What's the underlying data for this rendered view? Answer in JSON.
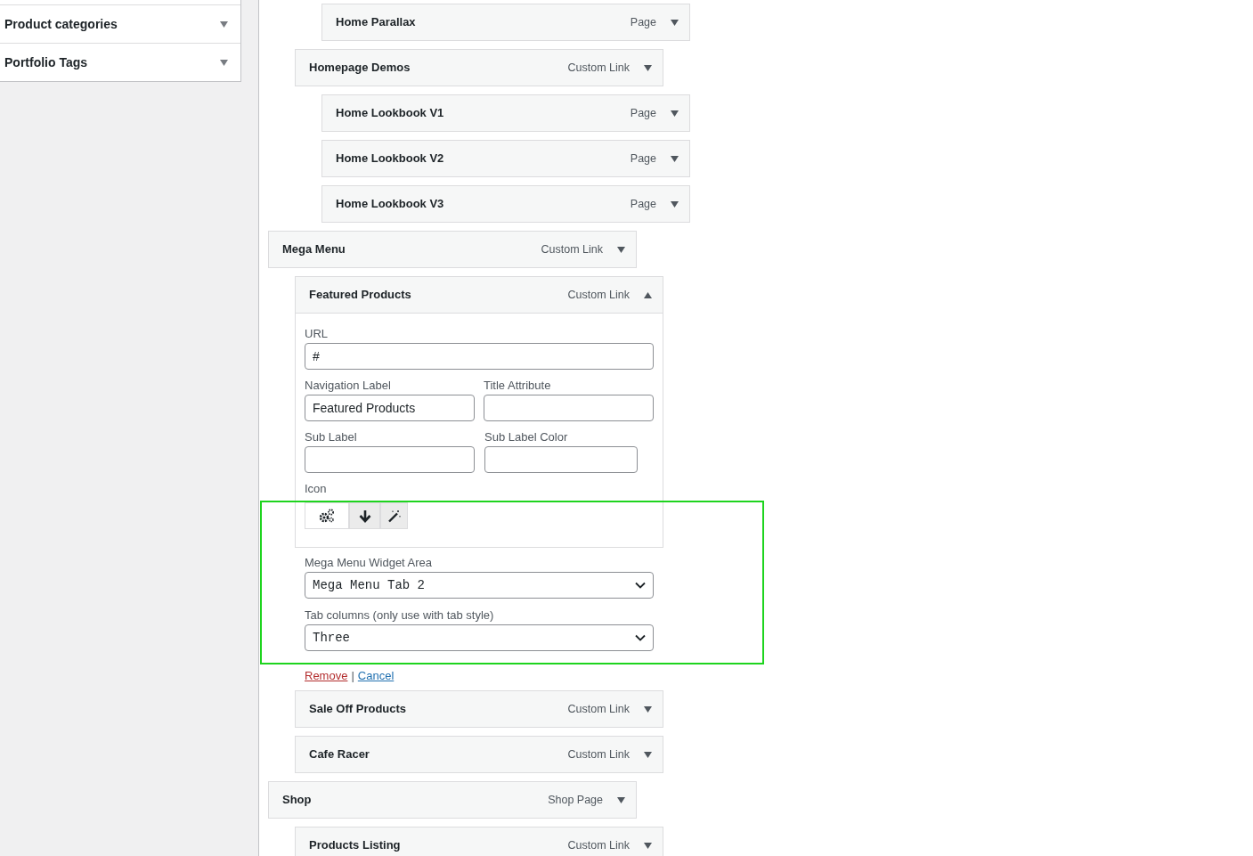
{
  "sidebar": {
    "sections": [
      {
        "title": "Product categories",
        "expanded": false
      },
      {
        "title": "Portfolio Tags",
        "expanded": false
      }
    ]
  },
  "menu_items": [
    {
      "children": [
        {
          "children": [
            {
              "title": "Home Parallax",
              "type": "Page",
              "expanded": false
            }
          ]
        },
        {
          "title": "Homepage Demos",
          "type": "Custom Link",
          "expanded": false,
          "children": [
            {
              "title": "Home Lookbook V1",
              "type": "Page",
              "expanded": false
            },
            {
              "title": "Home Lookbook V2",
              "type": "Page",
              "expanded": false
            },
            {
              "title": "Home Lookbook V3",
              "type": "Page",
              "expanded": false
            }
          ]
        }
      ]
    },
    {
      "title": "Mega Menu",
      "type": "Custom Link",
      "expanded": false,
      "children": [
        {
          "title": "Featured Products",
          "type": "Custom Link",
          "expanded": true,
          "settings": {
            "url": {
              "label": "URL",
              "value": "#"
            },
            "navigation_label": {
              "label": "Navigation Label",
              "value": "Featured Products"
            },
            "title_attribute": {
              "label": "Title Attribute"
            },
            "sub_label": {
              "label": "Sub Label"
            },
            "sub_label_color": {
              "label": "Sub Label Color"
            },
            "icon": {
              "label": "Icon"
            },
            "widget_area": {
              "label": "Mega Menu Widget Area",
              "value": "Mega Menu Tab 2"
            },
            "tab_columns": {
              "label": "Tab columns (only use with tab style)",
              "value": "Three"
            },
            "actions": [
              {
                "label": "Remove",
                "kind": "danger"
              },
              {
                "label": "Cancel",
                "kind": "link"
              }
            ],
            "separator": "|"
          }
        },
        {
          "title": "Sale Off Products",
          "type": "Custom Link",
          "expanded": false
        },
        {
          "title": "Cafe Racer",
          "type": "Custom Link",
          "expanded": false
        }
      ]
    },
    {
      "title": "Shop",
      "type": "Shop Page",
      "expanded": false,
      "children": [
        {
          "title": "Products Listing",
          "type": "Custom Link",
          "expanded": false
        }
      ]
    }
  ]
}
